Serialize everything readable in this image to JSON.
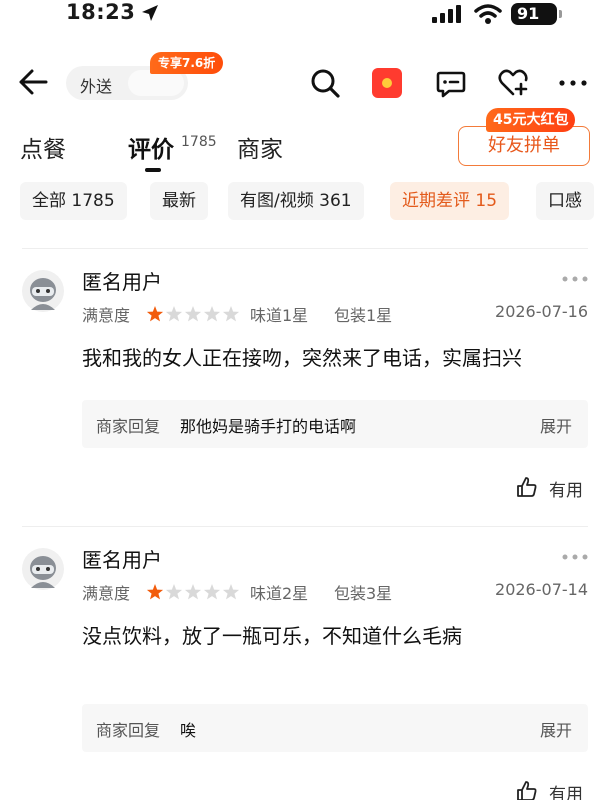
{
  "status_bar": {
    "time": "18:23",
    "battery": "91"
  },
  "nav": {
    "mode": "外送",
    "discount_badge": "专享7.6折"
  },
  "tabs": [
    {
      "label": "点餐"
    },
    {
      "label": "评价",
      "count": "1785"
    },
    {
      "label": "商家"
    }
  ],
  "group_buy": {
    "label": "好友拼单",
    "badge": "45元大红包"
  },
  "filters": [
    {
      "label": "全部 1785"
    },
    {
      "label": "最新"
    },
    {
      "label": "有图/视频 361"
    },
    {
      "label": "近期差评 15",
      "active": true
    },
    {
      "label": "口感"
    }
  ],
  "reviews": [
    {
      "user": "匿名用户",
      "satisfaction_label": "满意度",
      "rating": 1,
      "taste": "味道1星",
      "packaging": "包装1星",
      "date": "2026-07-16",
      "text": "我和我的女人正在接吻，突然来了电话，实属扫兴",
      "reply_label": "商家回复",
      "reply_text": "那他妈是骑手打的电话啊",
      "expand": "展开",
      "useful": "有用"
    },
    {
      "user": "匿名用户",
      "satisfaction_label": "满意度",
      "rating": 1,
      "taste": "味道2星",
      "packaging": "包装3星",
      "date": "2026-07-14",
      "text": "没点饮料，放了一瓶可乐，不知道什么毛病",
      "reply_label": "商家回复",
      "reply_text": "唉",
      "expand": "展开",
      "useful": "有用"
    }
  ],
  "colors": {
    "accent": "#e8581c",
    "star_on": "#f25c0c",
    "star_off": "#d9d9d9"
  }
}
